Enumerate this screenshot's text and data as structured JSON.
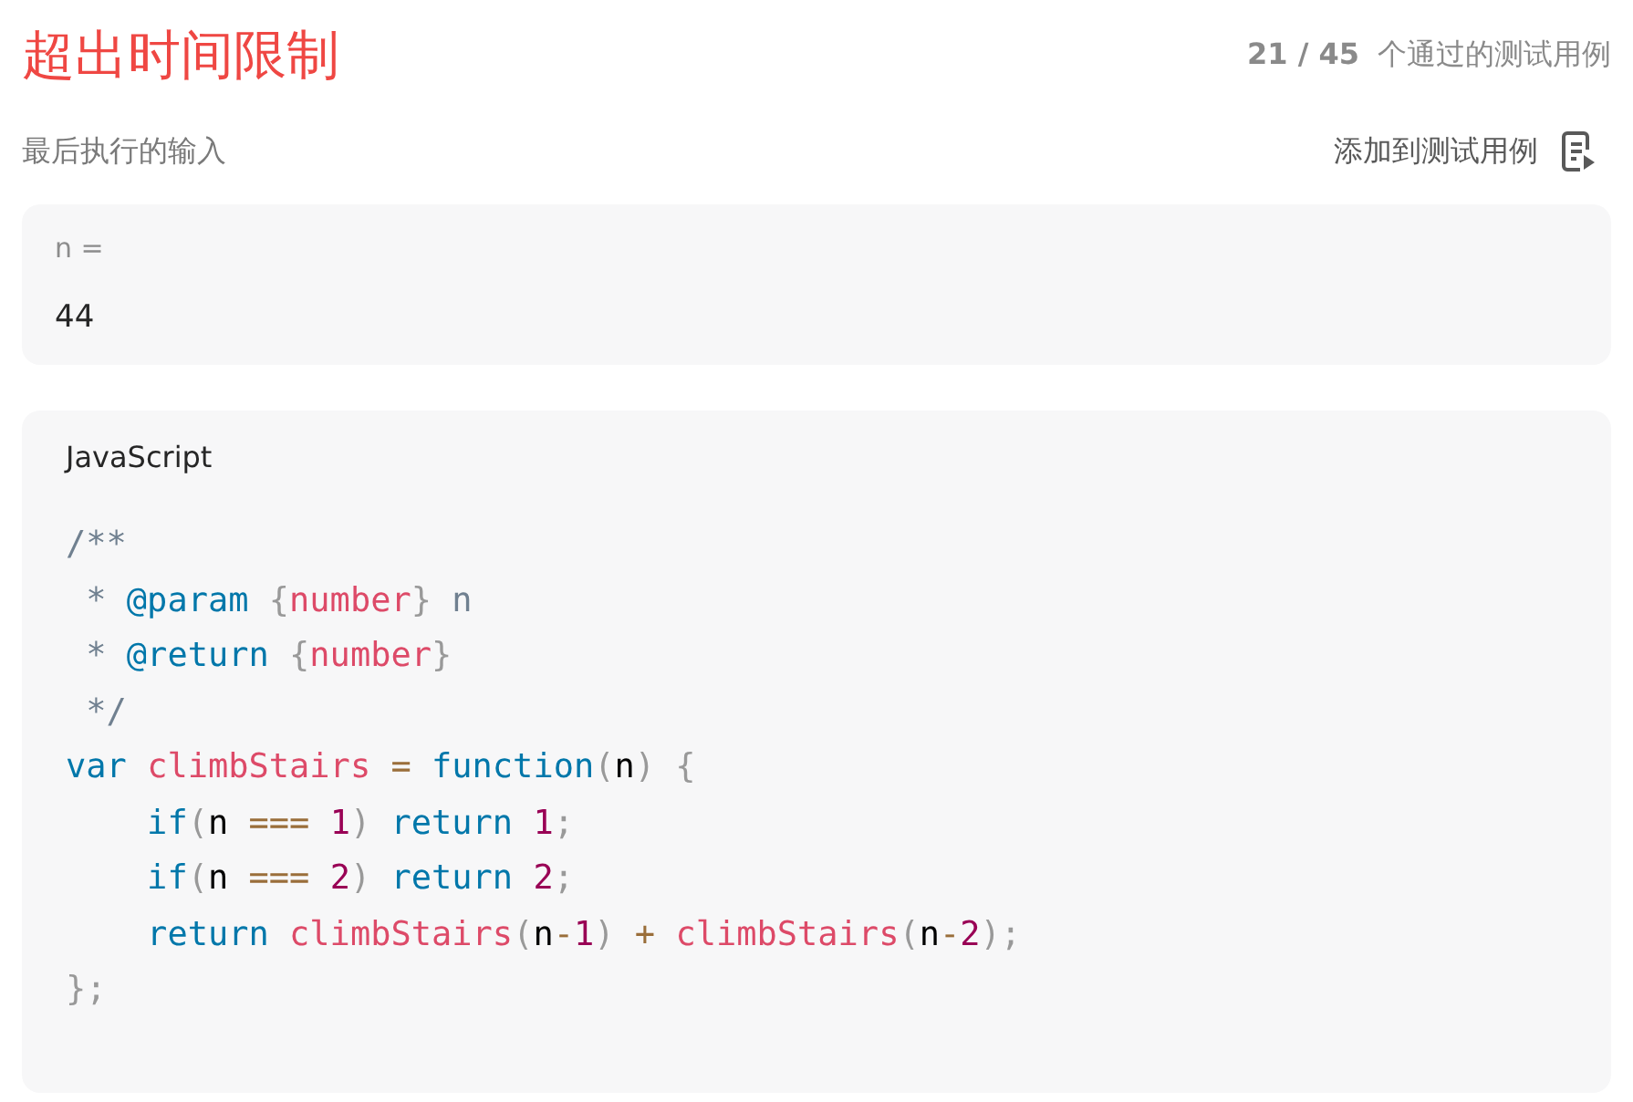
{
  "result": {
    "title": "超出时间限制",
    "passed": "21 / 45",
    "passed_label": "个通过的测试用例"
  },
  "last_input": {
    "label": "最后执行的输入",
    "action": "添加到测试用例"
  },
  "input": {
    "name": "n =",
    "value": "44"
  },
  "code": {
    "language": "JavaScript",
    "lines": [
      [
        {
          "kind": "comment",
          "text": "/**"
        }
      ],
      [
        {
          "kind": "comment",
          "text": " * "
        },
        {
          "kind": "keyword",
          "text": "@param "
        },
        {
          "kind": "punct",
          "text": "{"
        },
        {
          "kind": "name",
          "text": "number"
        },
        {
          "kind": "punct",
          "text": "}"
        },
        {
          "kind": "comment",
          "text": " n"
        }
      ],
      [
        {
          "kind": "comment",
          "text": " * "
        },
        {
          "kind": "keyword",
          "text": "@return "
        },
        {
          "kind": "punct",
          "text": "{"
        },
        {
          "kind": "name",
          "text": "number"
        },
        {
          "kind": "punct",
          "text": "}"
        }
      ],
      [
        {
          "kind": "comment",
          "text": " */"
        }
      ],
      [
        {
          "kind": "keyword",
          "text": "var "
        },
        {
          "kind": "name",
          "text": "climbStairs "
        },
        {
          "kind": "operator",
          "text": "= "
        },
        {
          "kind": "keyword",
          "text": "function"
        },
        {
          "kind": "punct",
          "text": "("
        },
        {
          "kind": "plain",
          "text": "n"
        },
        {
          "kind": "punct",
          "text": ") {"
        }
      ],
      [
        {
          "kind": "keyword",
          "text": "    if"
        },
        {
          "kind": "punct",
          "text": "("
        },
        {
          "kind": "plain",
          "text": "n "
        },
        {
          "kind": "operator",
          "text": "=== "
        },
        {
          "kind": "number",
          "text": "1"
        },
        {
          "kind": "punct",
          "text": ") "
        },
        {
          "kind": "keyword",
          "text": "return "
        },
        {
          "kind": "number",
          "text": "1"
        },
        {
          "kind": "punct",
          "text": ";"
        }
      ],
      [
        {
          "kind": "keyword",
          "text": "    if"
        },
        {
          "kind": "punct",
          "text": "("
        },
        {
          "kind": "plain",
          "text": "n "
        },
        {
          "kind": "operator",
          "text": "=== "
        },
        {
          "kind": "number",
          "text": "2"
        },
        {
          "kind": "punct",
          "text": ") "
        },
        {
          "kind": "keyword",
          "text": "return "
        },
        {
          "kind": "number",
          "text": "2"
        },
        {
          "kind": "punct",
          "text": ";"
        }
      ],
      [
        {
          "kind": "keyword",
          "text": "    return "
        },
        {
          "kind": "name",
          "text": "climbStairs"
        },
        {
          "kind": "punct",
          "text": "("
        },
        {
          "kind": "plain",
          "text": "n"
        },
        {
          "kind": "operator",
          "text": "-"
        },
        {
          "kind": "number",
          "text": "1"
        },
        {
          "kind": "punct",
          "text": ") "
        },
        {
          "kind": "operator",
          "text": "+ "
        },
        {
          "kind": "name",
          "text": "climbStairs"
        },
        {
          "kind": "punct",
          "text": "("
        },
        {
          "kind": "plain",
          "text": "n"
        },
        {
          "kind": "operator",
          "text": "-"
        },
        {
          "kind": "number",
          "text": "2"
        },
        {
          "kind": "punct",
          "text": ");"
        }
      ],
      [
        {
          "kind": "punct",
          "text": "};"
        }
      ]
    ]
  }
}
